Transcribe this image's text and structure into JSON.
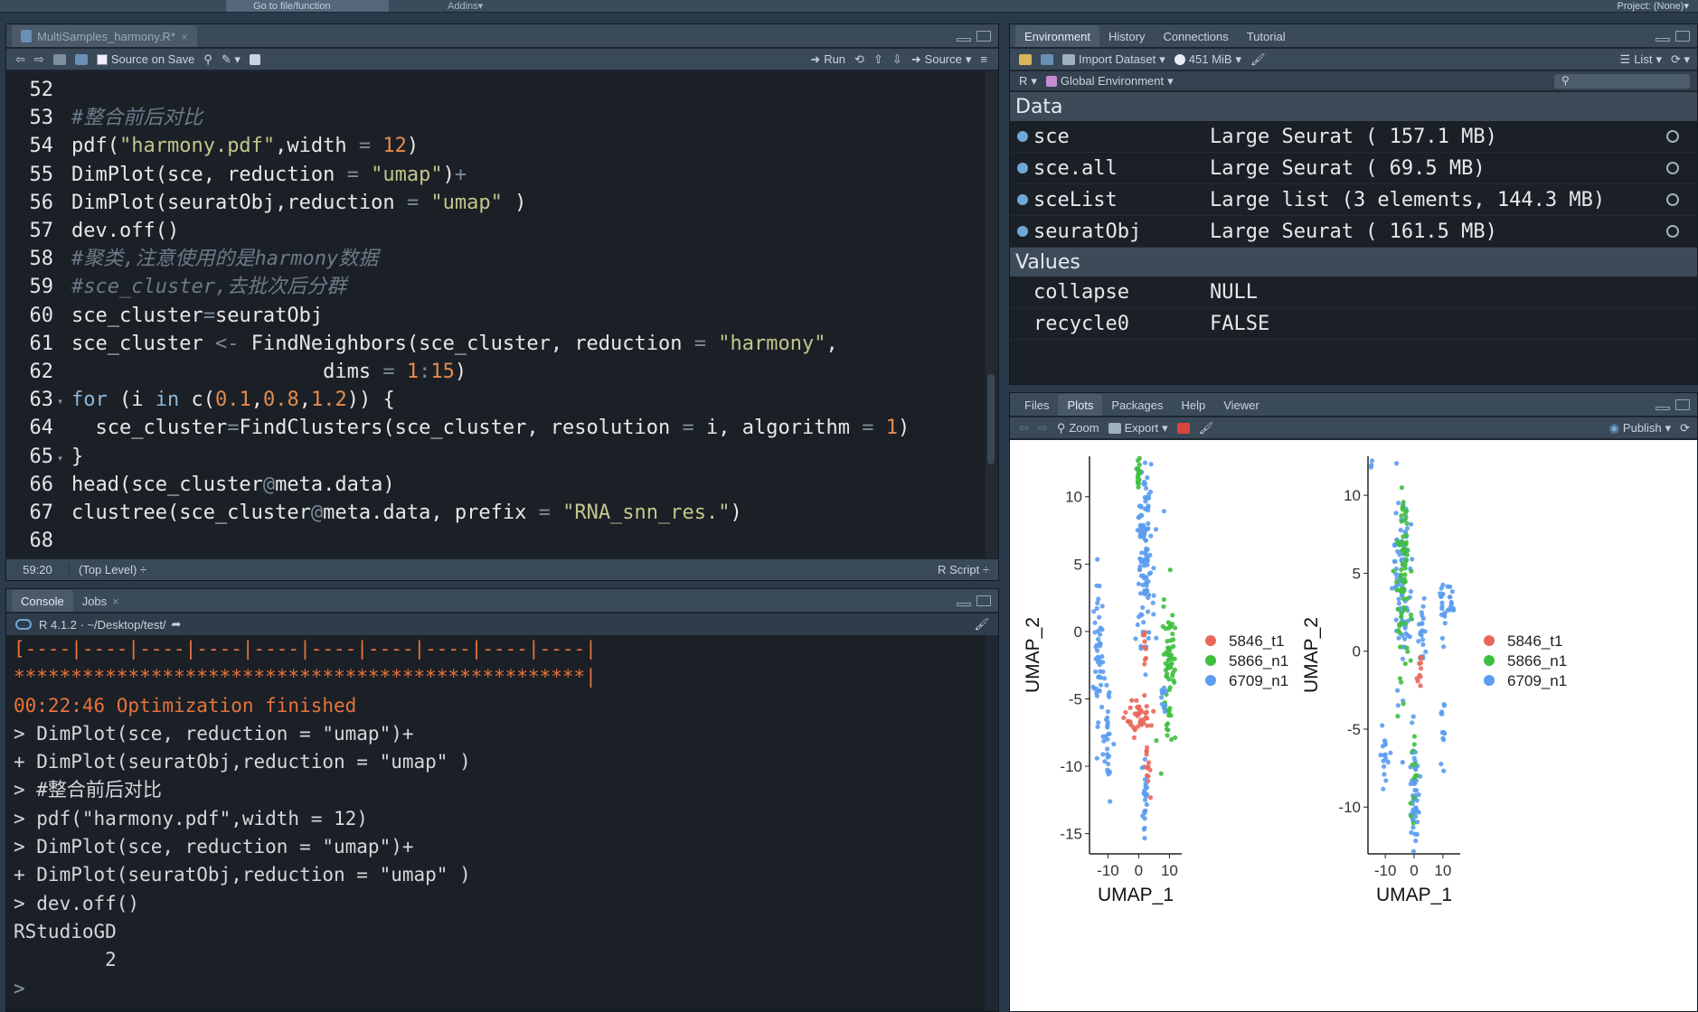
{
  "topbar": {
    "goto_label": "Go to file/function",
    "addins_label": "Addins",
    "project_label": "Project: (None)"
  },
  "editor": {
    "tab_label": "MultiSamples_harmony.R*",
    "toolbar": {
      "source_on_save": "Source on Save",
      "run": "Run",
      "source": "Source"
    },
    "lines": [
      {
        "n": "52",
        "segs": []
      },
      {
        "n": "53",
        "segs": [
          {
            "t": "#整合前后对比",
            "c": "cmt"
          }
        ]
      },
      {
        "n": "54",
        "segs": [
          {
            "t": "pdf(",
            "c": ""
          },
          {
            "t": "\"harmony.pdf\"",
            "c": "str"
          },
          {
            "t": ",width ",
            "c": ""
          },
          {
            "t": "=",
            "c": "op"
          },
          {
            "t": " ",
            "c": ""
          },
          {
            "t": "12",
            "c": "num"
          },
          {
            "t": ")",
            "c": ""
          }
        ]
      },
      {
        "n": "55",
        "segs": [
          {
            "t": "DimPlot(sce, reduction ",
            "c": ""
          },
          {
            "t": "=",
            "c": "op"
          },
          {
            "t": " ",
            "c": ""
          },
          {
            "t": "\"umap\"",
            "c": "str"
          },
          {
            "t": ")",
            "c": ""
          },
          {
            "t": "+",
            "c": "op"
          }
        ]
      },
      {
        "n": "56",
        "segs": [
          {
            "t": "DimPlot(seuratObj,reduction ",
            "c": ""
          },
          {
            "t": "=",
            "c": "op"
          },
          {
            "t": " ",
            "c": ""
          },
          {
            "t": "\"umap\"",
            "c": "str"
          },
          {
            "t": " )",
            "c": ""
          }
        ]
      },
      {
        "n": "57",
        "segs": [
          {
            "t": "dev.off()",
            "c": ""
          }
        ]
      },
      {
        "n": "58",
        "segs": [
          {
            "t": "#聚类,注意使用的是harmony数据",
            "c": "cmt"
          }
        ]
      },
      {
        "n": "59",
        "segs": [
          {
            "t": "#sce_cluster,去批次后分群",
            "c": "cmt"
          }
        ]
      },
      {
        "n": "60",
        "segs": [
          {
            "t": "sce_cluster",
            "c": ""
          },
          {
            "t": "=",
            "c": "op"
          },
          {
            "t": "seuratObj",
            "c": ""
          }
        ]
      },
      {
        "n": "61",
        "segs": [
          {
            "t": "sce_cluster ",
            "c": ""
          },
          {
            "t": "<-",
            "c": "op"
          },
          {
            "t": " FindNeighbors(sce_cluster, reduction ",
            "c": ""
          },
          {
            "t": "=",
            "c": "op"
          },
          {
            "t": " ",
            "c": ""
          },
          {
            "t": "\"harmony\"",
            "c": "str"
          },
          {
            "t": ",",
            "c": ""
          }
        ]
      },
      {
        "n": "62",
        "segs": [
          {
            "t": "                     dims ",
            "c": ""
          },
          {
            "t": "=",
            "c": "op"
          },
          {
            "t": " ",
            "c": ""
          },
          {
            "t": "1",
            "c": "num"
          },
          {
            "t": ":",
            "c": "op"
          },
          {
            "t": "15",
            "c": "num"
          },
          {
            "t": ")",
            "c": ""
          }
        ]
      },
      {
        "n": "63",
        "segs": [
          {
            "t": "for",
            "c": "kw"
          },
          {
            "t": " (i ",
            "c": ""
          },
          {
            "t": "in",
            "c": "kw"
          },
          {
            "t": " c(",
            "c": ""
          },
          {
            "t": "0.1",
            "c": "num"
          },
          {
            "t": ",",
            "c": ""
          },
          {
            "t": "0.8",
            "c": "num"
          },
          {
            "t": ",",
            "c": ""
          },
          {
            "t": "1.2",
            "c": "num"
          },
          {
            "t": ")) {",
            "c": ""
          }
        ],
        "fold": true
      },
      {
        "n": "64",
        "segs": [
          {
            "t": "  sce_cluster",
            "c": ""
          },
          {
            "t": "=",
            "c": "op"
          },
          {
            "t": "FindClusters(sce_cluster, resolution ",
            "c": ""
          },
          {
            "t": "=",
            "c": "op"
          },
          {
            "t": " i, algorithm ",
            "c": ""
          },
          {
            "t": "=",
            "c": "op"
          },
          {
            "t": " ",
            "c": ""
          },
          {
            "t": "1",
            "c": "num"
          },
          {
            "t": ")",
            "c": ""
          }
        ]
      },
      {
        "n": "65",
        "segs": [
          {
            "t": "}",
            "c": ""
          }
        ],
        "fold": true
      },
      {
        "n": "66",
        "segs": [
          {
            "t": "head(sce_cluster",
            "c": ""
          },
          {
            "t": "@",
            "c": "op"
          },
          {
            "t": "meta.data)",
            "c": ""
          }
        ]
      },
      {
        "n": "67",
        "segs": [
          {
            "t": "clustree(sce_cluster",
            "c": ""
          },
          {
            "t": "@",
            "c": "op"
          },
          {
            "t": "meta.data, prefix ",
            "c": ""
          },
          {
            "t": "=",
            "c": "op"
          },
          {
            "t": " ",
            "c": ""
          },
          {
            "t": "\"RNA_snn_res.\"",
            "c": "str"
          },
          {
            "t": ")",
            "c": ""
          }
        ]
      },
      {
        "n": "68",
        "segs": []
      }
    ],
    "status": {
      "position": "59:20",
      "level": "(Top Level) ÷",
      "filetype": "R Script ÷"
    }
  },
  "console": {
    "tabs": [
      "Console",
      "Jobs"
    ],
    "path": "R 4.1.2 · ~/Desktop/test/",
    "lines": [
      {
        "t": "[----|----|----|----|----|----|----|----|----|----|",
        "c": "orange"
      },
      {
        "t": "**************************************************|",
        "c": "orange"
      },
      {
        "t": "00:22:46 Optimization finished",
        "c": "orange"
      },
      {
        "t": "> DimPlot(sce, reduction = \"umap\")+",
        "c": ""
      },
      {
        "t": "+ DimPlot(seuratObj,reduction = \"umap\" )",
        "c": ""
      },
      {
        "t": "> #整合前后对比",
        "c": ""
      },
      {
        "t": "> pdf(\"harmony.pdf\",width = 12)",
        "c": ""
      },
      {
        "t": "> DimPlot(sce, reduction = \"umap\")+",
        "c": ""
      },
      {
        "t": "+ DimPlot(seuratObj,reduction = \"umap\" )",
        "c": ""
      },
      {
        "t": "> dev.off()",
        "c": ""
      },
      {
        "t": "RStudioGD",
        "c": ""
      },
      {
        "t": "        2",
        "c": ""
      },
      {
        "t": "> ",
        "c": "prompt"
      }
    ]
  },
  "environment": {
    "tabs": [
      "Environment",
      "History",
      "Connections",
      "Tutorial"
    ],
    "toolbar": {
      "import": "Import Dataset",
      "memory": "451 MiB",
      "view": "List"
    },
    "scope": {
      "lang": "R",
      "env": "Global Environment"
    },
    "data_header": "Data",
    "data": [
      {
        "name": "sce",
        "value": "Large Seurat ( 157.1 MB)"
      },
      {
        "name": "sce.all",
        "value": "Large Seurat ( 69.5 MB)"
      },
      {
        "name": "sceList",
        "value": "Large list (3 elements,  144.3 MB)"
      },
      {
        "name": "seuratObj",
        "value": "Large Seurat ( 161.5 MB)"
      }
    ],
    "values_header": "Values",
    "values": [
      {
        "name": "collapse",
        "value": "NULL"
      },
      {
        "name": "recycle0",
        "value": "FALSE"
      }
    ]
  },
  "plots": {
    "tabs": [
      "Files",
      "Plots",
      "Packages",
      "Help",
      "Viewer"
    ],
    "toolbar": {
      "zoom": "Zoom",
      "export": "Export",
      "publish": "Publish"
    }
  },
  "chart_data": [
    {
      "type": "scatter",
      "xlabel": "UMAP_1",
      "ylabel": "UMAP_2",
      "xticks": [
        "-10",
        "0",
        "10"
      ],
      "yticks": [
        "10",
        "5",
        "0",
        "-5",
        "-10",
        "-15"
      ],
      "xlim": [
        -16,
        14
      ],
      "ylim": [
        -16.5,
        13
      ],
      "legend": [
        "5846_t1",
        "5866_n1",
        "6709_n1"
      ],
      "colors": [
        "#e8685c",
        "#3fbf3f",
        "#5b9cf0"
      ],
      "clusters": [
        {
          "series": 2,
          "x": 2,
          "y": 7,
          "sx": 1.6,
          "sy": 5,
          "n": 140
        },
        {
          "series": 1,
          "x": 0,
          "y": 11.8,
          "sx": 0.3,
          "sy": 0.7,
          "n": 16
        },
        {
          "series": 2,
          "x": -13,
          "y": -2,
          "sx": 0.8,
          "sy": 3,
          "n": 50
        },
        {
          "series": 1,
          "x": 10,
          "y": -2.5,
          "sx": 1.0,
          "sy": 2.3,
          "n": 70
        },
        {
          "series": 0,
          "x": 0,
          "y": -6.3,
          "sx": 2.5,
          "sy": 0.6,
          "n": 40
        },
        {
          "series": 2,
          "x": -10,
          "y": -8,
          "sx": 0.6,
          "sy": 2,
          "n": 30
        },
        {
          "series": 0,
          "x": 3,
          "y": -10.5,
          "sx": 0.5,
          "sy": 1,
          "n": 14
        },
        {
          "series": 2,
          "x": 2,
          "y": -12.5,
          "sx": 0.5,
          "sy": 1.5,
          "n": 22
        },
        {
          "series": 0,
          "x": 2,
          "y": -1.5,
          "sx": 0.5,
          "sy": 0.8,
          "n": 10
        },
        {
          "series": 2,
          "x": 8,
          "y": -5,
          "sx": 0.6,
          "sy": 1.0,
          "n": 12
        }
      ]
    },
    {
      "type": "scatter",
      "xlabel": "UMAP_1",
      "ylabel": "UMAP_2",
      "xticks": [
        "-10",
        "0",
        "10"
      ],
      "yticks": [
        "10",
        "5",
        "0",
        "-5",
        "-10"
      ],
      "xlim": [
        -16,
        16
      ],
      "ylim": [
        -13,
        12.5
      ],
      "legend": [
        "5846_t1",
        "5866_n1",
        "6709_n1"
      ],
      "colors": [
        "#e8685c",
        "#3fbf3f",
        "#5b9cf0"
      ],
      "clusters": [
        {
          "series": 2,
          "x": -4,
          "y": 4,
          "sx": 1.6,
          "sy": 3.5,
          "n": 90
        },
        {
          "series": 1,
          "x": -4,
          "y": 5,
          "sx": 1.3,
          "sy": 3.5,
          "n": 70
        },
        {
          "series": 2,
          "x": 3,
          "y": 1,
          "sx": 0.6,
          "sy": 1.2,
          "n": 20
        },
        {
          "series": 0,
          "x": 2,
          "y": -1.3,
          "sx": 0.5,
          "sy": 0.6,
          "n": 10
        },
        {
          "series": 2,
          "x": 10,
          "y": 3,
          "sx": 0.6,
          "sy": 1.2,
          "n": 18
        },
        {
          "series": 2,
          "x": 13,
          "y": 3,
          "sx": 0.6,
          "sy": 0.4,
          "n": 12
        },
        {
          "series": 2,
          "x": 10,
          "y": -5,
          "sx": 0.4,
          "sy": 1.2,
          "n": 12
        },
        {
          "series": 2,
          "x": -10,
          "y": -6.5,
          "sx": 0.7,
          "sy": 1.0,
          "n": 16
        },
        {
          "series": 2,
          "x": 0,
          "y": -9,
          "sx": 0.8,
          "sy": 2.0,
          "n": 50
        },
        {
          "series": 1,
          "x": 0,
          "y": -8,
          "sx": 0.5,
          "sy": 1.6,
          "n": 12
        },
        {
          "series": 2,
          "x": -15,
          "y": 12,
          "sx": 0.2,
          "sy": 0.3,
          "n": 3
        }
      ]
    }
  ]
}
